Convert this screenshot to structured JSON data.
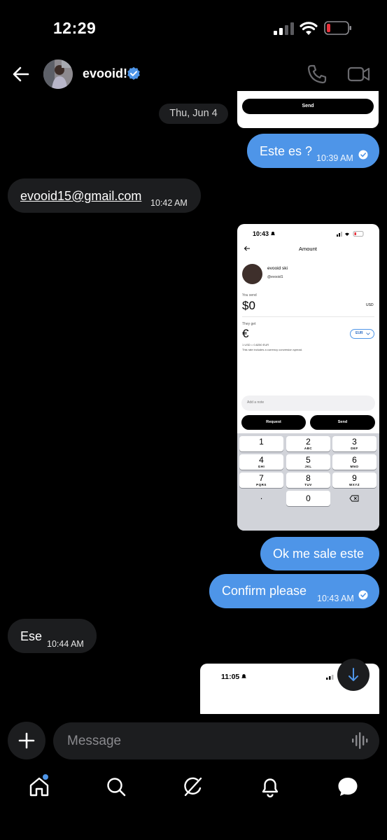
{
  "status_bar": {
    "time": "12:29"
  },
  "header": {
    "username": "evooid!"
  },
  "chat": {
    "date_separator": "Thu, Jun 4",
    "prev_screenshot": {
      "send_label": "Send"
    },
    "messages": [
      {
        "direction": "out",
        "text": "Este es ?",
        "time": "10:39 AM"
      },
      {
        "direction": "in",
        "text": "evooid15@gmail.com",
        "time": "10:42 AM"
      },
      {
        "direction": "out",
        "text": "Ok me sale este",
        "time": ""
      },
      {
        "direction": "out",
        "text": "Confirm please",
        "time": "10:43 AM"
      },
      {
        "direction": "in",
        "text": "Ese",
        "time": "10:44 AM"
      }
    ],
    "screenshot": {
      "time": "10:43",
      "title": "Amount",
      "profile_name": "evooid ski",
      "profile_handle": "@evooid1",
      "you_send_label": "You send",
      "you_send_amount": "$0",
      "you_send_currency": "USD",
      "they_get_label": "They get",
      "they_get_symbol": "€",
      "they_get_currency": "EUR",
      "rate": "1 USD = 0.8250 EUR",
      "rate_note": "This rate includes a currency conversion spread.",
      "note_placeholder": "Add a note",
      "request_label": "Request",
      "send_label": "Send",
      "keypad": [
        {
          "digit": "1",
          "letters": ""
        },
        {
          "digit": "2",
          "letters": "ABC"
        },
        {
          "digit": "3",
          "letters": "DEF"
        },
        {
          "digit": "4",
          "letters": "GHI"
        },
        {
          "digit": "5",
          "letters": "JKL"
        },
        {
          "digit": "6",
          "letters": "MNO"
        },
        {
          "digit": "7",
          "letters": "PQRS"
        },
        {
          "digit": "8",
          "letters": "TUV"
        },
        {
          "digit": "9",
          "letters": "WXYZ"
        },
        {
          "digit": ".",
          "letters": ""
        },
        {
          "digit": "0",
          "letters": ""
        }
      ]
    },
    "screenshot2": {
      "time": "11:05"
    }
  },
  "composer": {
    "placeholder": "Message"
  },
  "colors": {
    "accent": "#4e95e8",
    "bubble_incoming": "#1c1d1f",
    "background": "#000000",
    "battery_low": "#e8323c"
  },
  "icons": {
    "back": "arrow-left-icon",
    "verified": "verified-badge-icon",
    "call": "phone-icon",
    "video": "video-camera-icon",
    "add": "plus-icon",
    "voice": "waveform-icon",
    "scroll": "arrow-down-icon",
    "nav": [
      "home-icon",
      "search-icon",
      "grok-icon",
      "bell-icon",
      "messages-icon"
    ]
  }
}
